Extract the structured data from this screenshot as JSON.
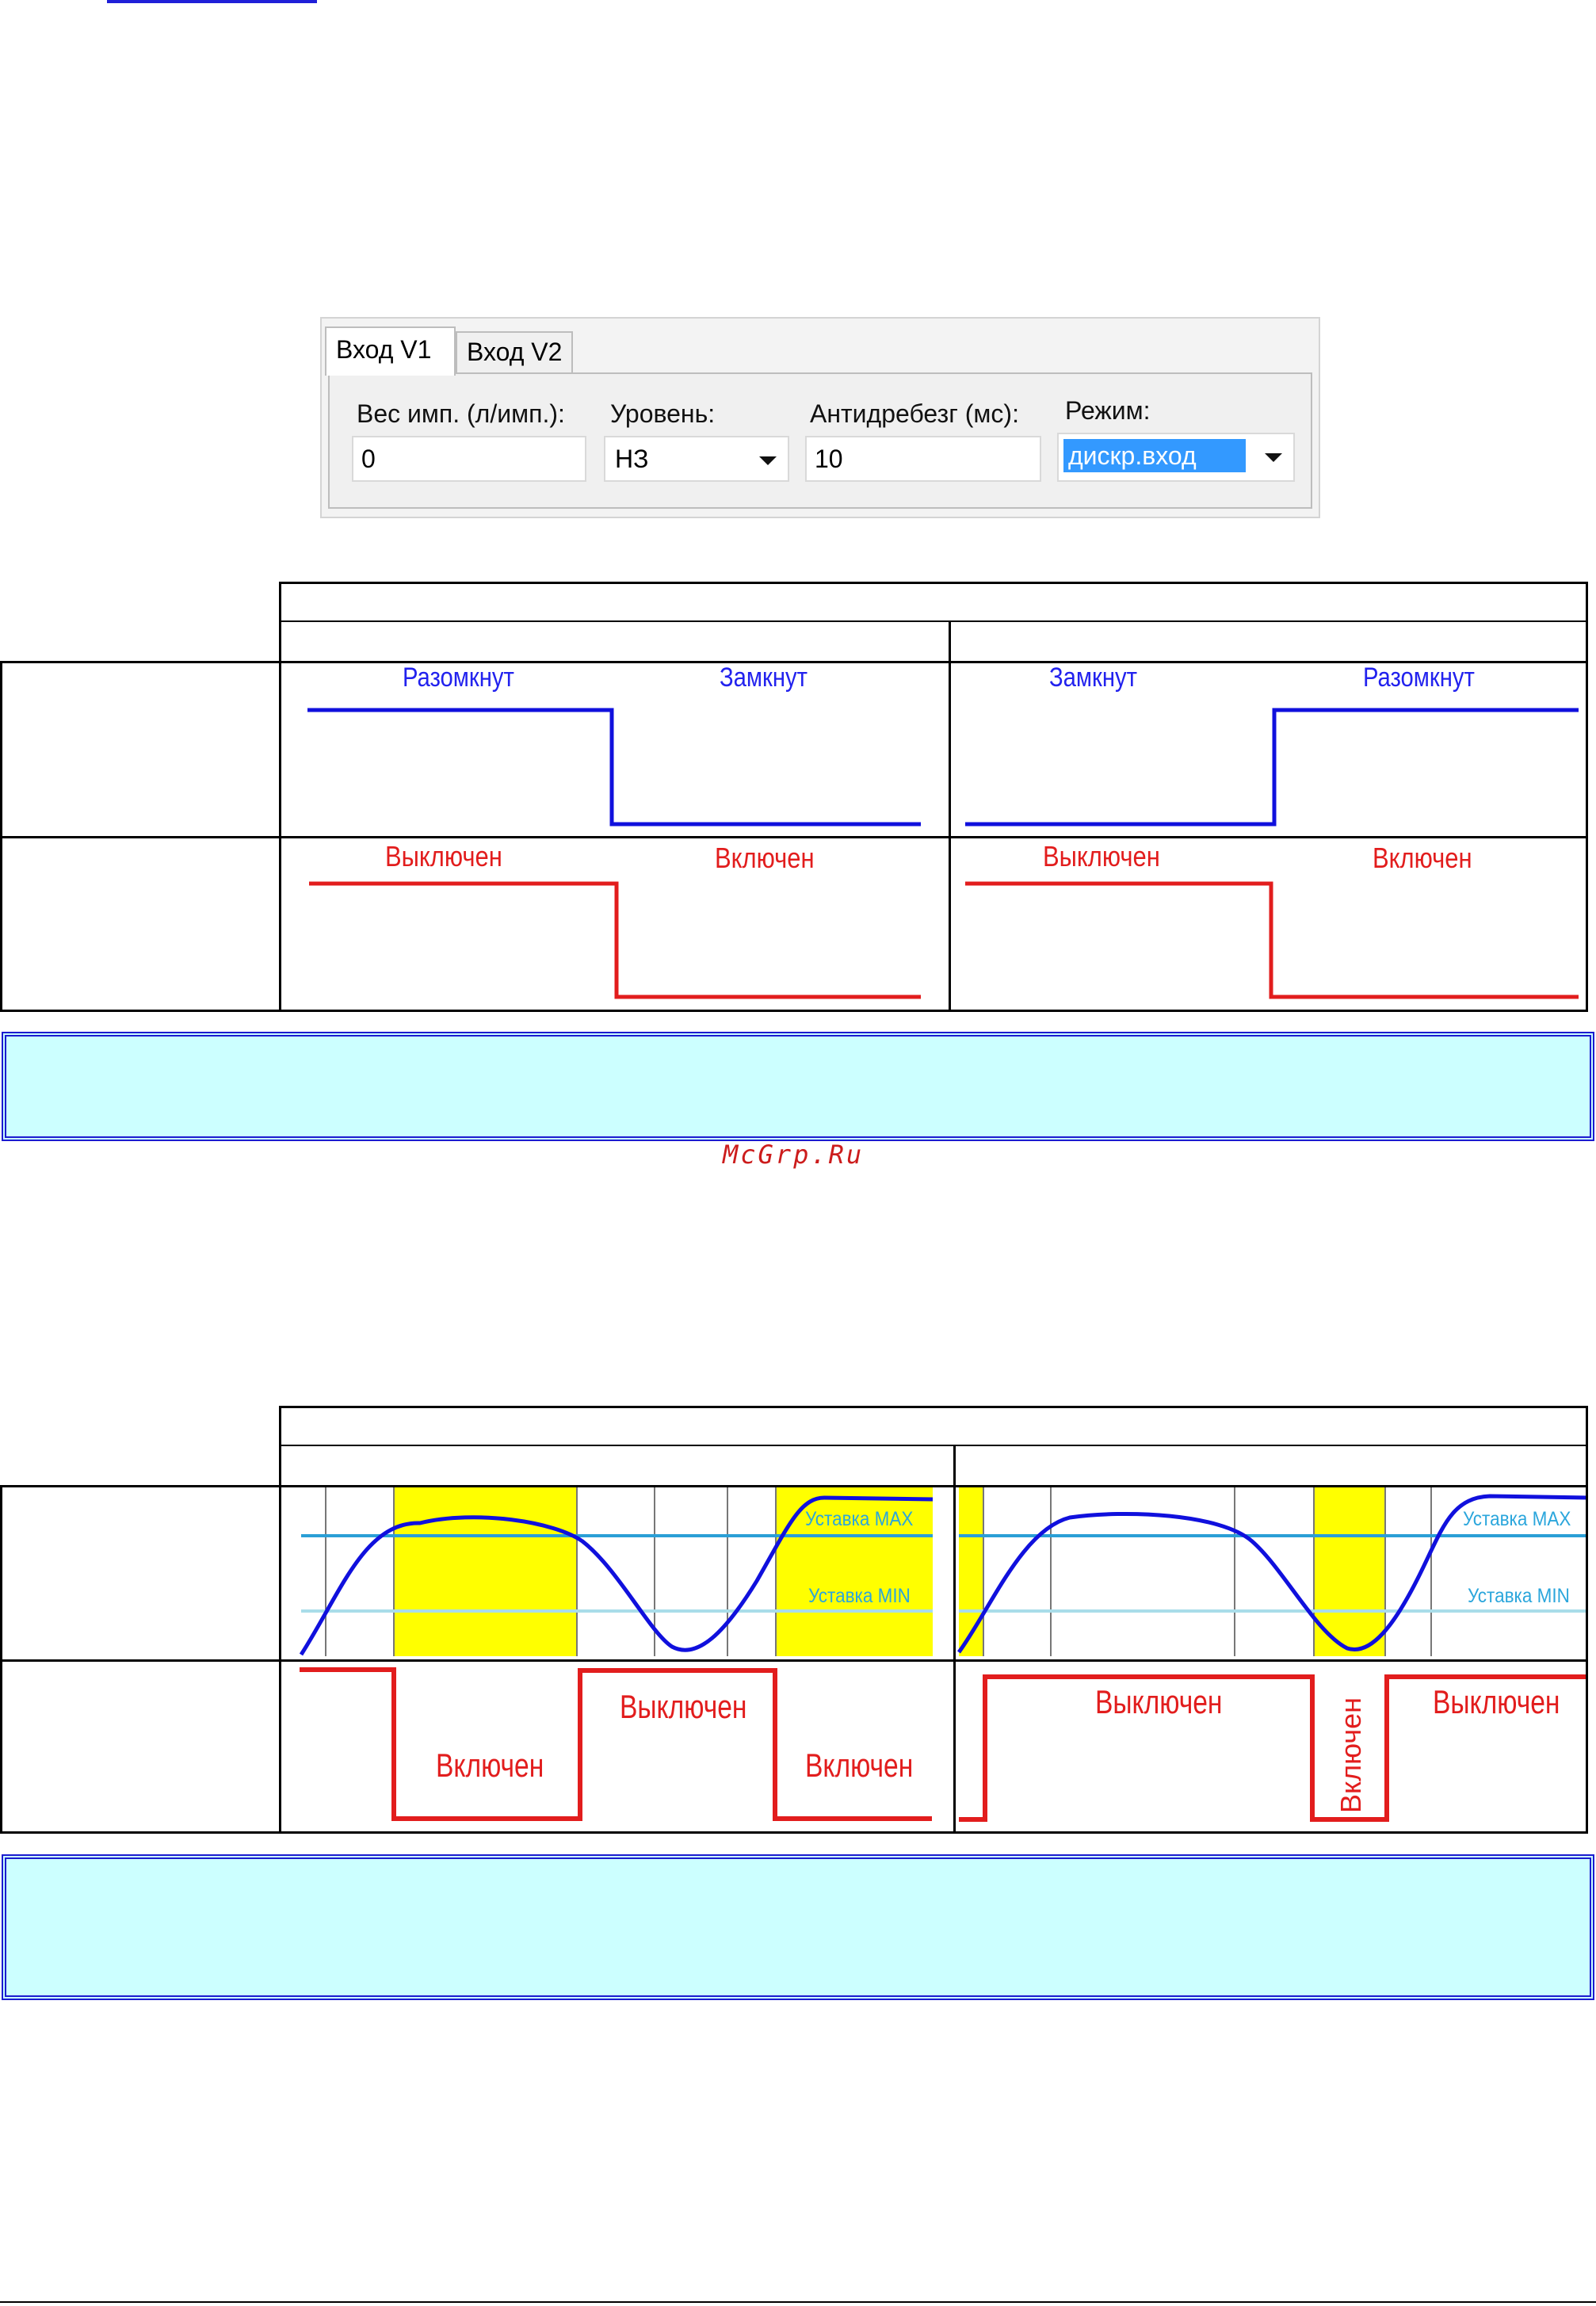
{
  "settings_panel": {
    "tabs": [
      {
        "label": "Вход V1"
      },
      {
        "label": "Вход V2"
      }
    ],
    "fields": {
      "weight": {
        "label": "Вес имп. (л/имп.):",
        "value": "0"
      },
      "level": {
        "label": "Уровень:",
        "value": "НЗ"
      },
      "debounce": {
        "label": "Антидребезг (мс):",
        "value": "10"
      },
      "mode": {
        "label": "Режим:",
        "value": "дискр.вход"
      }
    }
  },
  "diagram1": {
    "row1": {
      "left": [
        "Разомкнут",
        "Замкнут"
      ],
      "right": [
        "Замкнут",
        "Разомкнут"
      ]
    },
    "row2": {
      "left": [
        "Выключен",
        "Включен"
      ],
      "right": [
        "Выключен",
        "Включен"
      ]
    }
  },
  "watermark": "McGrp.Ru",
  "diagram2": {
    "setpoint_max": "Уставка MAX",
    "setpoint_min": "Уставка MIN",
    "left": [
      "Включен",
      "Выключен",
      "Включен"
    ],
    "right": [
      "Выключен",
      "Включен",
      "Выключен"
    ]
  },
  "colors": {
    "blue_curve": "#1010dd",
    "red_curve": "#e21d1d",
    "highlight": "#ffff00",
    "setpoint_max_line": "#2a9fd6",
    "setpoint_min_line": "#a9dde9",
    "note_fill": "#ccffff",
    "note_border": "#1b1bd0"
  }
}
